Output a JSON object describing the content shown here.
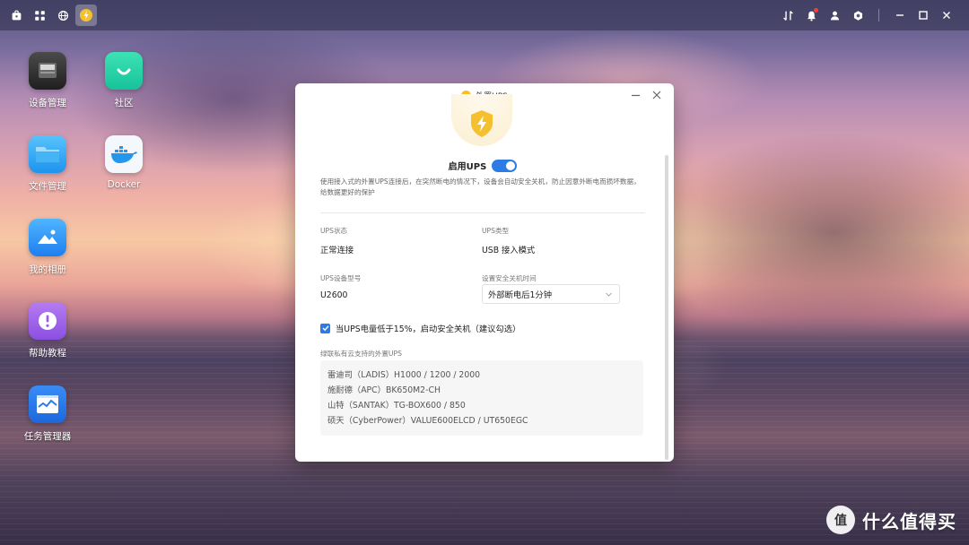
{
  "taskbar": {
    "left_icons": [
      "home-icon",
      "apps-grid-icon",
      "globe-icon",
      "ups-app-icon"
    ],
    "right_icons": [
      "network-transfer-icon",
      "bell-icon",
      "user-icon",
      "settings-gear-icon"
    ],
    "window_controls": [
      "minimize-icon",
      "restore-icon",
      "close-icon"
    ],
    "notification_badge_color": "#ff3b30"
  },
  "desktop": {
    "icons": [
      {
        "label": "设备管理",
        "icon": "device-manager-icon"
      },
      {
        "label": "社区",
        "icon": "community-icon"
      },
      {
        "label": "文件管理",
        "icon": "file-manager-icon"
      },
      {
        "label": "Docker",
        "icon": "docker-icon"
      },
      {
        "label": "我的相册",
        "icon": "photo-album-icon"
      },
      {
        "label": "帮助教程",
        "icon": "help-icon"
      },
      {
        "label": "任务管理器",
        "icon": "task-manager-icon"
      }
    ]
  },
  "dialog": {
    "title": "外置UPS",
    "enable_label": "启用UPS",
    "enabled": true,
    "description": "使用接入式的外置UPS连接后，在突然断电的情况下，设备会自动安全关机，防止因意外断电而损坏数据，给数据更好的保护",
    "fields": {
      "status_label": "UPS状态",
      "status_value": "正常连接",
      "type_label": "UPS类型",
      "type_value": "USB 接入模式",
      "model_label": "UPS设备型号",
      "model_value": "U2600",
      "shutdown_label": "设置安全关机时间",
      "shutdown_value": "外部断电后1分钟"
    },
    "low_battery_checkbox": {
      "checked": true,
      "label": "当UPS电量低于15%，启动安全关机（建议勾选）"
    },
    "supported_label": "绿联私有云支持的外置UPS",
    "supported_list": [
      "雷迪司（LADIS）H1000 / 1200 / 2000",
      "施耐德（APC）BK650M2-CH",
      "山特（SANTAK）TG-BOX600 / 850",
      "硕天（CyberPower）VALUE600ELCD / UT650EGC"
    ],
    "accent_color": "#2d7be5"
  },
  "watermark": {
    "text": "什么值得买",
    "logo": "值"
  }
}
